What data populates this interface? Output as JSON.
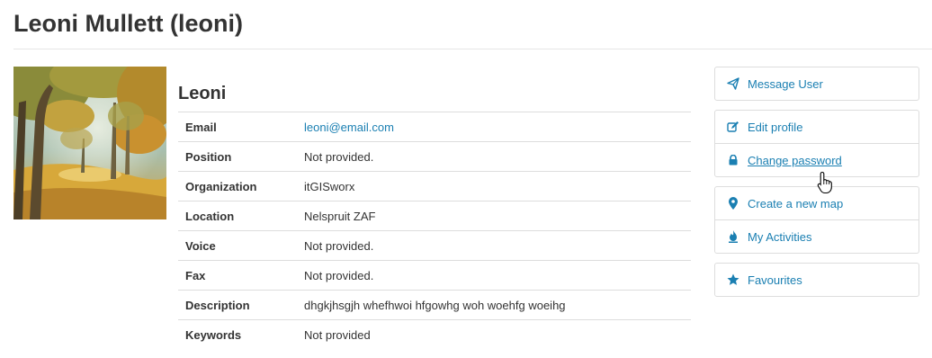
{
  "page": {
    "title": "Leoni Mullett (leoni)"
  },
  "profile": {
    "display_name": "Leoni",
    "fields": [
      {
        "label": "Email",
        "value": "leoni@email.com",
        "is_link": true
      },
      {
        "label": "Position",
        "value": "Not provided."
      },
      {
        "label": "Organization",
        "value": "itGISworx"
      },
      {
        "label": "Location",
        "value": "Nelspruit ZAF"
      },
      {
        "label": "Voice",
        "value": "Not provided."
      },
      {
        "label": "Fax",
        "value": "Not provided."
      },
      {
        "label": "Description",
        "value": "dhgkjhsgjh whefhwoi hfgowhg woh woehfg woeihg"
      },
      {
        "label": "Keywords",
        "value": "Not provided"
      }
    ]
  },
  "actions": {
    "message_user": "Message User",
    "edit_profile": "Edit profile",
    "change_password": "Change password",
    "create_map": "Create a new map",
    "my_activities": "My Activities",
    "favourites": "Favourites"
  },
  "colors": {
    "link": "#1a7fb2",
    "text": "#333333",
    "border": "#dddddd"
  },
  "icons": {
    "message_user": "paper-plane-icon",
    "edit_profile": "pencil-square-icon",
    "change_password": "lock-icon",
    "create_map": "map-marker-icon",
    "my_activities": "fire-icon",
    "favourites": "star-icon"
  }
}
